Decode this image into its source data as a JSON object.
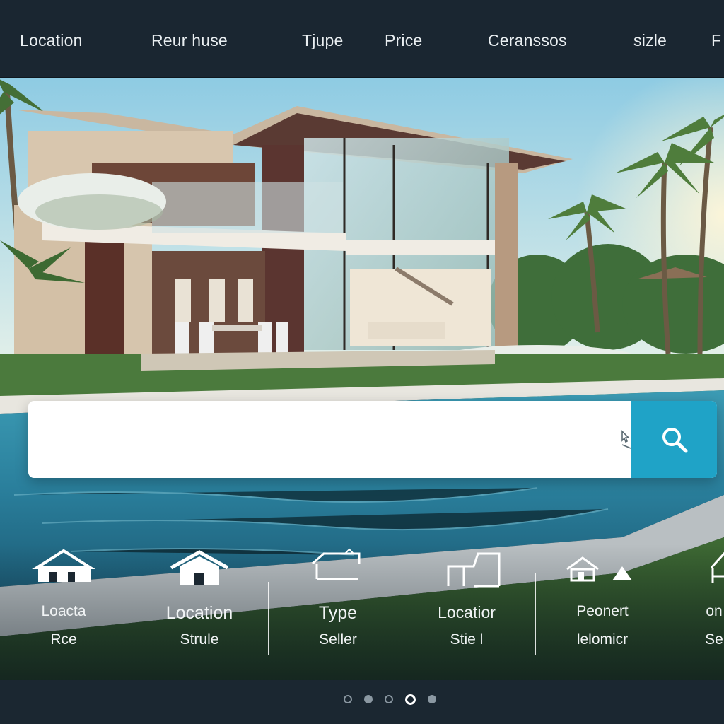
{
  "nav": {
    "items": [
      {
        "label": "Location"
      },
      {
        "label": "Reur huse"
      },
      {
        "label": "Tjupe"
      },
      {
        "label": "Price"
      },
      {
        "label": "Ceranssos"
      },
      {
        "label": "sizle"
      },
      {
        "label": "F"
      }
    ]
  },
  "search": {
    "value": "",
    "placeholder": "",
    "button_icon": "search-icon",
    "accent_color": "#1fa3c7"
  },
  "features": [
    {
      "icon": "house-roof-icon",
      "line1": "Loacta",
      "line2": "Rce"
    },
    {
      "icon": "house-icon",
      "line1": "Location",
      "line2": "Strule"
    },
    {
      "icon": "roof-outline-icon",
      "line1": "Type",
      "line2": "Seller"
    },
    {
      "icon": "building-outline-icon",
      "line1": "Locatior",
      "line2": "Stie l"
    },
    {
      "icon": "house-warning-icon",
      "line1": "Peonert",
      "line2": "lelomicr"
    },
    {
      "icon": "house-partial-icon",
      "line1": "on",
      "line2": "Se"
    }
  ],
  "pagination": {
    "total": 5,
    "active_index": 3
  }
}
